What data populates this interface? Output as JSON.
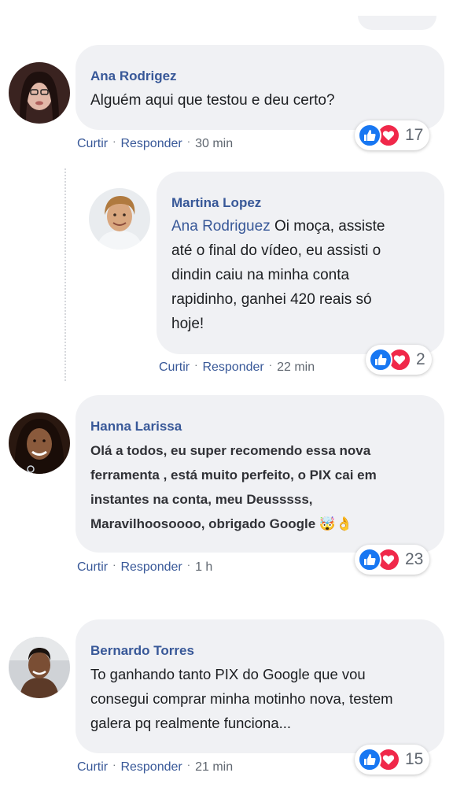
{
  "comments": [
    {
      "author": "Ana Rodrigez",
      "lines": [
        "Alguém aqui que testou e deu certo?"
      ],
      "like_label": "Curtir",
      "reply_label": "Responder",
      "time": "30 min",
      "reactions": "17"
    },
    {
      "author": "Martina Lopez",
      "mention": "Ana Rodriguez",
      "lines": [
        " Oi moça, assiste",
        "até o final do vídeo, eu assisti o",
        "dindin caiu na minha conta",
        "rapidinho, ganhei 420 reais só",
        "hoje!"
      ],
      "like_label": "Curtir",
      "reply_label": "Responder",
      "time": "22 min",
      "reactions": "2"
    },
    {
      "author": "Hanna Larissa",
      "lines": [
        "Olá a todos, eu super recomendo essa nova",
        "ferramenta , está muito perfeito, o PIX cai em",
        "instantes na conta, meu Deusssss,",
        "Maravilhoosoooo, obrigado Google 🤯👌"
      ],
      "like_label": "Curtir",
      "reply_label": "Responder",
      "time": "1 h",
      "reactions": "23"
    },
    {
      "author": "Bernardo Torres",
      "lines": [
        "To ganhando tanto PIX do Google que vou",
        "consegui comprar minha motinho nova, testem",
        "galera pq realmente funciona..."
      ],
      "like_label": "Curtir",
      "reply_label": "Responder",
      "time": "21 min",
      "reactions": "15"
    }
  ],
  "separator": "·",
  "icons": {
    "like": "thumbs-up-icon",
    "love": "heart-icon"
  },
  "colors": {
    "name": "#385898",
    "bubble": "#f0f1f4",
    "like": "#1877f2",
    "love": "#f0284a"
  }
}
